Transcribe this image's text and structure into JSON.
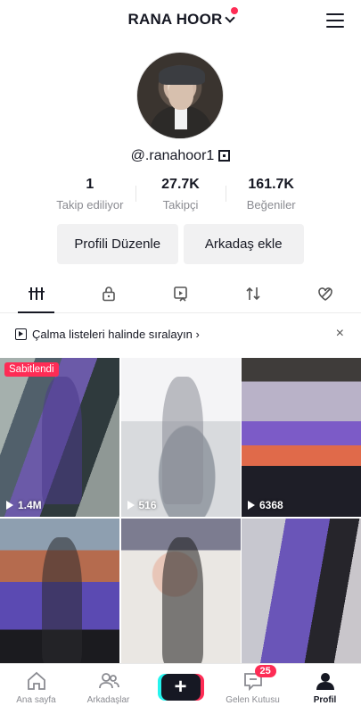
{
  "header": {
    "username": "RANA HOOR",
    "menu_icon": "hamburger-icon"
  },
  "profile": {
    "handle": "@.ranahoor1",
    "stats": [
      {
        "num": "1",
        "label": "Takip ediliyor"
      },
      {
        "num": "27.7K",
        "label": "Takipçi"
      },
      {
        "num": "161.7K",
        "label": "Beğeniler"
      }
    ],
    "edit_button": "Profili Düzenle",
    "add_friend_button": "Arkadaş ekle"
  },
  "tabs": [
    "videos-grid-icon",
    "private-lock-icon",
    "reposts-icon",
    "repost-arrows-icon",
    "liked-icon"
  ],
  "banner": {
    "text": "Çalma listeleri halinde sıralayın",
    "close": "×"
  },
  "videos": [
    {
      "views": "1.4M",
      "pinned_label": "Sabitlendi"
    },
    {
      "views": "516"
    },
    {
      "views": "6368"
    },
    {
      "views": ""
    },
    {
      "views": ""
    },
    {
      "views": ""
    }
  ],
  "bottom_nav": {
    "home": "Ana sayfa",
    "friends": "Arkadaşlar",
    "inbox": "Gelen Kutusu",
    "inbox_badge": "25",
    "profile": "Profil",
    "create": "+"
  },
  "colors": {
    "accent": "#fe2c55",
    "text": "#161823",
    "muted": "#8a8b91"
  }
}
